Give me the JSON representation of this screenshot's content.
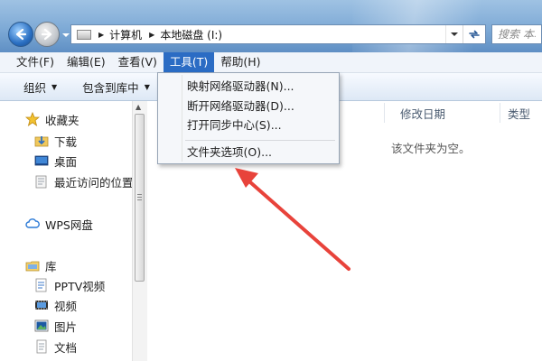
{
  "address": {
    "crumbs": [
      "计算机",
      "本地磁盘 (I:)"
    ],
    "search_placeholder": "搜索 本地磁盘 (I:)"
  },
  "menubar": {
    "items": [
      {
        "label": "文件(F)"
      },
      {
        "label": "编辑(E)"
      },
      {
        "label": "查看(V)"
      },
      {
        "label": "工具(T)",
        "active": true
      },
      {
        "label": "帮助(H)"
      }
    ]
  },
  "commandbar": {
    "organize": "组织",
    "include_in_library": "包含到库中"
  },
  "tools_menu": {
    "items": [
      {
        "label": "映射网络驱动器(N)..."
      },
      {
        "label": "断开网络驱动器(D)..."
      },
      {
        "label": "打开同步中心(S)..."
      },
      {
        "label": "文件夹选项(O)..."
      }
    ]
  },
  "navpane": {
    "favorites": {
      "label": "收藏夹",
      "items": [
        {
          "label": "下载"
        },
        {
          "label": "桌面"
        },
        {
          "label": "最近访问的位置"
        }
      ]
    },
    "wps": {
      "label": "WPS网盘"
    },
    "libraries": {
      "label": "库",
      "items": [
        {
          "label": "PPTV视频"
        },
        {
          "label": "视频"
        },
        {
          "label": "图片"
        },
        {
          "label": "文档"
        }
      ]
    }
  },
  "content": {
    "columns": [
      "修改日期",
      "类型"
    ],
    "empty_message": "该文件夹为空。"
  },
  "colors": {
    "accent": "#2b6cc4",
    "annotation_arrow": "#e8433b"
  }
}
